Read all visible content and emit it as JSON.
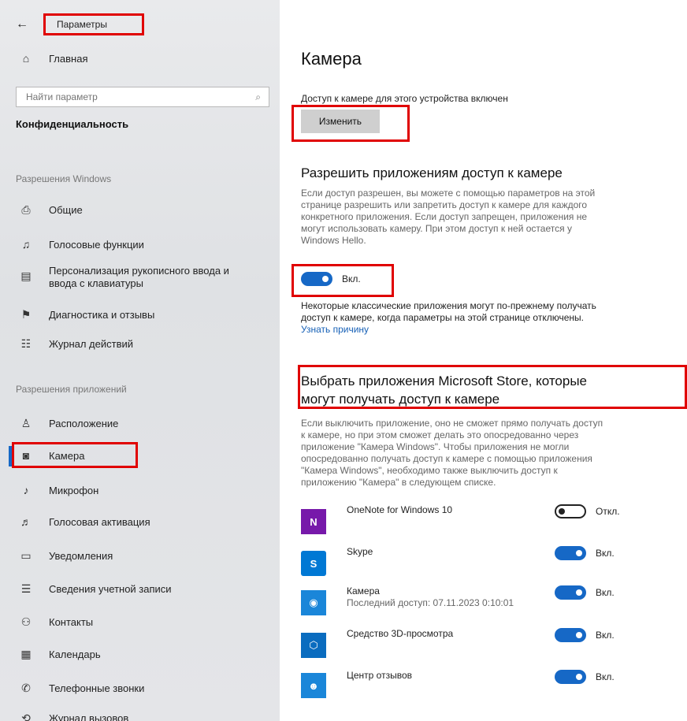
{
  "window": {
    "title": "Параметры"
  },
  "sidebar": {
    "home": "Главная",
    "search_placeholder": "Найти параметр",
    "category": "Конфиденциальность",
    "windows_section": "Разрешения Windows",
    "windows_items": [
      {
        "label": "Общие",
        "icon": "lock-icon"
      },
      {
        "label": "Голосовые функции",
        "icon": "voice-icon"
      },
      {
        "label": "Персонализация рукописного ввода и",
        "label2": "ввода с клавиатуры",
        "icon": "notepad-icon"
      },
      {
        "label": "Диагностика и отзывы",
        "icon": "feedback-icon"
      },
      {
        "label": "Журнал действий",
        "icon": "activity-icon"
      }
    ],
    "apps_section": "Разрешения приложений",
    "app_items": [
      {
        "label": "Расположение",
        "icon": "location-icon"
      },
      {
        "label": "Камера",
        "icon": "camera-icon",
        "active": true
      },
      {
        "label": "Микрофон",
        "icon": "microphone-icon"
      },
      {
        "label": "Голосовая активация",
        "icon": "voice-activation-icon"
      },
      {
        "label": "Уведомления",
        "icon": "notification-icon"
      },
      {
        "label": "Сведения учетной записи",
        "icon": "account-info-icon"
      },
      {
        "label": "Контакты",
        "icon": "contacts-icon"
      },
      {
        "label": "Календарь",
        "icon": "calendar-icon"
      },
      {
        "label": "Телефонные звонки",
        "icon": "phone-icon"
      },
      {
        "label": "Журнал вызовов",
        "icon": "call-history-icon"
      }
    ]
  },
  "main": {
    "title": "Камера",
    "device_access_text": "Доступ к камере для этого устройства включен",
    "change_button": "Изменить",
    "allow_heading": "Разрешить приложениям доступ к камере",
    "allow_desc": [
      "Если доступ разрешен, вы можете с помощью параметров на этой",
      "странице разрешить или запретить доступ к камере для каждого",
      "конкретного приложения. Если доступ запрещен, приложения не",
      "могут использовать камеру. При этом доступ к ней остается у",
      "Windows Hello."
    ],
    "allow_toggle": {
      "state": "on",
      "label": "Вкл."
    },
    "classic_note": [
      "Некоторые классические приложения могут по-прежнему получать",
      "доступ к камере, когда параметры на этой странице отключены."
    ],
    "learn_link": "Узнать причину",
    "store_heading": [
      "Выбрать приложения Microsoft Store, которые",
      "могут получать доступ к камере"
    ],
    "store_desc": [
      "Если выключить приложение, оно не сможет прямо получать доступ",
      "к камере, но при этом сможет делать это опосредованно через",
      "приложение \"Камера Windows\". Чтобы приложения не могли",
      "опосредованно получать доступ к камере с помощью приложения",
      "\"Камера Windows\", необходимо также выключить доступ к",
      "приложению \"Камера\" в следующем списке."
    ],
    "apps": [
      {
        "name": "OneNote for Windows 10",
        "toggle": "off",
        "toggle_label": "Откл.",
        "icon": "onenote-icon",
        "color": "#7719aa"
      },
      {
        "name": "Skype",
        "toggle": "on",
        "toggle_label": "Вкл.",
        "icon": "skype-icon",
        "color": "#0078d4"
      },
      {
        "name": "Камера",
        "sub": "Последний доступ: 07.11.2023 0:10:01",
        "toggle": "on",
        "toggle_label": "Вкл.",
        "icon": "camera-app-icon",
        "color": "#1a86d9"
      },
      {
        "name": "Средство 3D-просмотра",
        "toggle": "on",
        "toggle_label": "Вкл.",
        "icon": "3d-viewer-icon",
        "color": "#0a6cbf"
      },
      {
        "name": "Центр отзывов",
        "toggle": "on",
        "toggle_label": "Вкл.",
        "icon": "feedback-hub-icon",
        "color": "#1a86d9"
      }
    ]
  },
  "colors": {
    "accent": "#1668c6",
    "highlight": "#e00000"
  }
}
